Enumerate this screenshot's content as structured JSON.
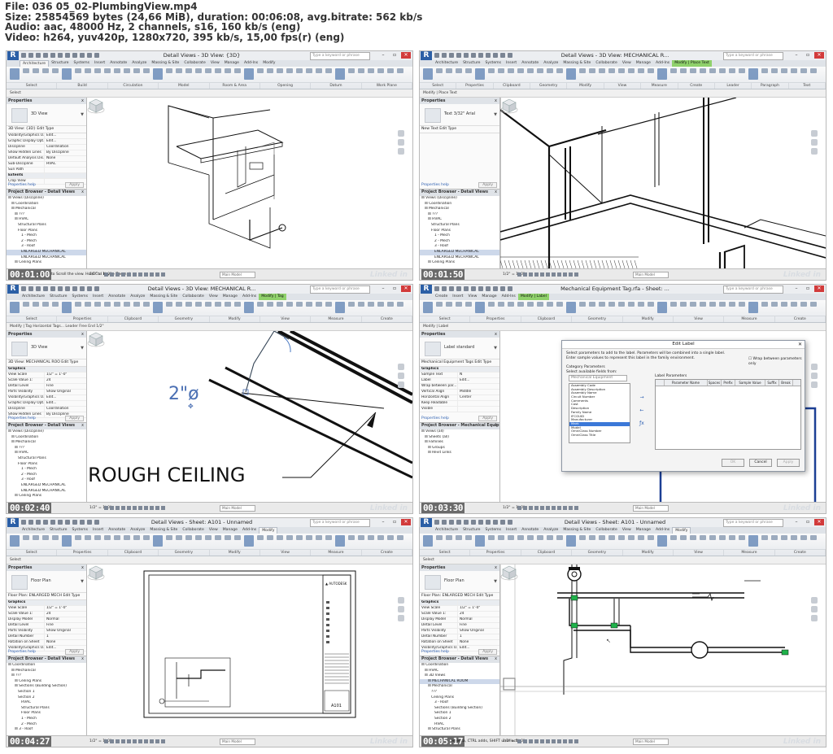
{
  "header": {
    "line1": "File: 036 05_02-PlumbingView.mp4",
    "line2": "Size: 25854569 bytes (24,66 MiB), duration: 00:06:08, avg.bitrate: 562 kb/s",
    "line3": "Audio: aac, 48000 Hz, 2 channels, s16, 160 kb/s (eng)",
    "line4": "Video: h264, yuv420p, 1280x720, 395 kb/s, 15,00 fps(r) (eng)"
  },
  "common": {
    "search_placeholder": "Type a keyword or phrase",
    "scale": "1/2\" = 1'-0\"",
    "model": "Main Model",
    "watermark": "Linked in",
    "apply": "Apply",
    "help": "Properties help",
    "props_title": "Properties",
    "edit_type": "Edit Type"
  },
  "frames": [
    {
      "timestamp": "00:01:00",
      "title": "Detail Views - 3D View: {3D}",
      "tabs": [
        "Architecture",
        "Structure",
        "Systems",
        "Insert",
        "Annotate",
        "Analyze",
        "Massing & Site",
        "Collaborate",
        "View",
        "Manage",
        "Add-Ins",
        "Modify"
      ],
      "active_tab": 0,
      "context_tab": "",
      "panels": [
        "Select",
        "Build",
        "Circulation",
        "Model",
        "Room & Area",
        "Opening",
        "Datum",
        "Work Plane"
      ],
      "ribbon_items": [
        "Roof",
        "Curtain System",
        "Railing",
        "Model Text",
        "Room",
        "Room Separator",
        "Wall",
        "Shaft",
        "Set",
        "Show"
      ],
      "optbar": "Select",
      "type_name": "3D View",
      "selector": "3D View: {3D}",
      "props": [
        [
          "Visibility/Graphics O...",
          "Edit..."
        ],
        [
          "Graphic Display Opt...",
          "Edit..."
        ],
        [
          "Discipline",
          "Coordination"
        ],
        [
          "Show Hidden Lines",
          "By Discipline"
        ],
        [
          "Default Analysis Dis...",
          "None"
        ],
        [
          "Sub-Discipline",
          "HVAC"
        ],
        [
          "Sun Path",
          ""
        ],
        [
          "Extents",
          ""
        ],
        [
          "Crop View",
          ""
        ]
      ],
      "browser_title": "Project Browser - Detail Views",
      "browser": [
        "Views (Discipline)",
        "Coordination",
        "Mechanical",
        "???",
        "HVAC",
        "Structural Plans",
        "Floor Plans",
        "1 - Mech",
        "2 - Mech",
        "3 - Roof",
        "ENLARGED MECHANICAL",
        "ENLARGED MECHANICAL",
        "Ceiling Plans"
      ],
      "browser_sel": 10,
      "status_msg": "mouse to Scroll the view. Hold Ctrl key to Zoom. I",
      "drawing": "iso1"
    },
    {
      "timestamp": "00:01:50",
      "title": "Detail Views - 3D View: MECHANICAL R...",
      "tabs": [
        "Architecture",
        "Structure",
        "Systems",
        "Insert",
        "Annotate",
        "Analyze",
        "Massing & Site",
        "Collaborate",
        "View",
        "Manage",
        "Add-Ins",
        "Modify | Place Text"
      ],
      "active_tab": 11,
      "context_tab": "Modify | Place Text",
      "panels": [
        "Select",
        "Properties",
        "Clipboard",
        "Geometry",
        "Modify",
        "View",
        "Measure",
        "Create",
        "Leader",
        "Paragraph",
        "Text"
      ],
      "ribbon_items": [
        "Cope",
        "Cut",
        "Join",
        "Check Spelling",
        "Find/Replace"
      ],
      "optbar": "Modify | Place Text",
      "type_name": "Text 3/32\" Arial",
      "selector": "New Text",
      "props": [],
      "browser_title": "Project Browser - Detail Views",
      "browser": [
        "Views (Discipline)",
        "Coordination",
        "Mechanical",
        "???",
        "HVAC",
        "Structural Plans",
        "Floor Plans",
        "1 - Mech",
        "2 - Mech",
        "3 - Roof",
        "ENLARGED MECHANICAL",
        "ENLARGED MECHANICAL",
        "Ceiling Plans"
      ],
      "browser_sel": 10,
      "status_msg": "",
      "drawing": "iso2"
    },
    {
      "timestamp": "00:02:40",
      "title": "Detail Views - 3D View: MECHANICAL R...",
      "tabs": [
        "Architecture",
        "Structure",
        "Systems",
        "Insert",
        "Annotate",
        "Analyze",
        "Massing & Site",
        "Collaborate",
        "View",
        "Manage",
        "Add-Ins",
        "Modify | Tag"
      ],
      "active_tab": 11,
      "context_tab": "Modify | Tag",
      "panels": [
        "Select",
        "Properties",
        "Clipboard",
        "Geometry",
        "Modify",
        "View",
        "Measure",
        "Create"
      ],
      "ribbon_items": [
        "Cope",
        "Cut",
        "Join"
      ],
      "optbar": "Modify | Tag   Horizontal   Tags...   Leader   Free End   1/2\"",
      "type_name": "3D View",
      "selector": "3D View: MECHANICAL ROO",
      "props": [
        [
          "Graphics",
          ""
        ],
        [
          "View Scale",
          "1/2\" = 1'-0\""
        ],
        [
          "Scale Value  1:",
          "24"
        ],
        [
          "Detail Level",
          "Fine"
        ],
        [
          "Parts Visibility",
          "Show Original"
        ],
        [
          "Visibility/Graphics O...",
          "Edit..."
        ],
        [
          "Graphic Display Opt...",
          "Edit..."
        ],
        [
          "Discipline",
          "Coordination"
        ],
        [
          "Show Hidden Lines",
          "By Discipline"
        ]
      ],
      "browser_title": "Project Browser - Detail Views",
      "browser": [
        "Views (Discipline)",
        "Coordination",
        "Mechanical",
        "???",
        "HVAC",
        "Structural Plans",
        "Floor Plans",
        "1 - Mech",
        "2 - Mech",
        "3 - Roof",
        "ENLARGED MECHANICAL",
        "ENLARGED MECHANICAL",
        "Ceiling Plans"
      ],
      "browser_sel": -1,
      "status_msg": "",
      "drawing": "closeup",
      "big_label": "2\"ø",
      "big_note": "IROUGH CEILING"
    },
    {
      "timestamp": "00:03:30",
      "title": "Mechanical Equipment Tag.rfa - Sheet: ...",
      "tabs": [
        "Create",
        "Insert",
        "View",
        "Manage",
        "Add-Ins",
        "Modify | Label"
      ],
      "active_tab": 5,
      "context_tab": "Modify | Label",
      "panels": [
        "Select",
        "Properties",
        "Clipboard",
        "Geometry",
        "Modify",
        "View",
        "Measure",
        "Create"
      ],
      "ribbon_items": [
        "Cope",
        "Cut",
        "Join"
      ],
      "optbar": "Modify | Label",
      "type_name": "Label standard",
      "selector": "Mechanical Equipment Tags",
      "props": [
        [
          "Graphics",
          ""
        ],
        [
          "Sample Text",
          "N"
        ],
        [
          "Label",
          "Edit..."
        ],
        [
          "Wrap between par...",
          ""
        ],
        [
          "Vertical Align",
          "Middle"
        ],
        [
          "Horizontal Align",
          "Center"
        ],
        [
          "Keep Readable",
          ""
        ],
        [
          "Visible",
          ""
        ]
      ],
      "browser_title": "Project Browser - Mechanical Equipment Tag...",
      "browser": [
        "Views (all)",
        "Sheets (all)",
        "Families",
        "Groups",
        "Revit Links"
      ],
      "browser_sel": -1,
      "status_msg": "",
      "drawing": "dialog",
      "dialog": {
        "title": "Edit Label",
        "instr1": "Select parameters to add to the label. Parameters will be combined into a single label.",
        "instr2": "Enter sample values to represent this label in the family environment.",
        "wrap": "Wrap between parameters only",
        "cat": "Category Parameters",
        "avail": "Select available fields from:",
        "field_sel": "Mechanical Equipment",
        "fields": [
          "Assembly Code",
          "Assembly Description",
          "Assembly Name",
          "Circuit Number",
          "Comments",
          "Cost",
          "Description",
          "Family Name",
          "IFCGUID",
          "Manufacturer",
          "Mark",
          "Model",
          "OmniClass Number",
          "OmniClass Title"
        ],
        "field_hl": 10,
        "label_params": "Label Parameters",
        "cols": [
          "",
          "Parameter Name",
          "Spaces",
          "Prefix",
          "Sample Value",
          "Suffix",
          "Break"
        ],
        "ok": "OK",
        "cancel": "Cancel",
        "apply": "Apply"
      }
    },
    {
      "timestamp": "00:04:27",
      "title": "Detail Views - Sheet: A101 - Unnamed",
      "tabs": [
        "Architecture",
        "Structure",
        "Systems",
        "Insert",
        "Annotate",
        "Analyze",
        "Massing & Site",
        "Collaborate",
        "View",
        "Manage",
        "Add-Ins",
        "Modify"
      ],
      "active_tab": 11,
      "context_tab": "",
      "panels": [
        "Select",
        "Properties",
        "Clipboard",
        "Geometry",
        "Modify",
        "View",
        "Measure",
        "Create"
      ],
      "ribbon_items": [
        "Cope",
        "Cut",
        "Join"
      ],
      "optbar": "Select",
      "type_name": "Floor Plan",
      "selector": "Floor Plan: ENLARGED MECH",
      "props": [
        [
          "Graphics",
          ""
        ],
        [
          "View Scale",
          "1/2\" = 1'-0\""
        ],
        [
          "Scale Value  1:",
          "24"
        ],
        [
          "Display Model",
          "Normal"
        ],
        [
          "Detail Level",
          "Fine"
        ],
        [
          "Parts Visibility",
          "Show Original"
        ],
        [
          "Detail Number",
          "1"
        ],
        [
          "Rotation on Sheet",
          "None"
        ],
        [
          "Visibility/Graphics O...",
          "Edit..."
        ]
      ],
      "browser_title": "Project Browser - Detail Views",
      "browser": [
        "Coordination",
        "Mechanical",
        "???",
        "Ceiling Plans",
        "Sections (Building Section)",
        "Section 1",
        "Section 2",
        "HVAC",
        "Structural Plans",
        "Floor Plans",
        "1 - Mech",
        "2 - Mech",
        "3 - Roof"
      ],
      "browser_sel": -1,
      "status_msg": "",
      "drawing": "sheet",
      "sheet_logo": "AUTODESK",
      "sheet_no": "A101"
    },
    {
      "timestamp": "00:05:17",
      "title": "Detail Views - Sheet: A101 - Unnamed",
      "tabs": [
        "Architecture",
        "Structure",
        "Systems",
        "Insert",
        "Annotate",
        "Analyze",
        "Massing & Site",
        "Collaborate",
        "View",
        "Manage",
        "Add-Ins",
        "Modify"
      ],
      "active_tab": 11,
      "context_tab": "",
      "panels": [
        "Select",
        "Properties",
        "Clipboard",
        "Geometry",
        "Modify",
        "View",
        "Measure",
        "Create"
      ],
      "ribbon_items": [
        "Cope",
        "Cut",
        "Join"
      ],
      "optbar": "Select",
      "type_name": "Floor Plan",
      "selector": "Floor Plan: ENLARGED MECH",
      "props": [
        [
          "Graphics",
          ""
        ],
        [
          "View Scale",
          "1/2\" = 1'-0\""
        ],
        [
          "Scale Value  1:",
          "24"
        ],
        [
          "Display Model",
          "Normal"
        ],
        [
          "Detail Level",
          "Fine"
        ],
        [
          "Parts Visibility",
          "Show Original"
        ],
        [
          "Detail Number",
          "1"
        ],
        [
          "Rotation on Sheet",
          "None"
        ],
        [
          "Visibility/Graphics O...",
          "Edit..."
        ]
      ],
      "browser_title": "Project Browser - Detail Views",
      "browser": [
        "Coordination",
        "HVAC",
        "3D Views",
        "MECHANICAL ROOM",
        "Mechanical",
        "???",
        "Ceiling Plans",
        "3 - Roof",
        "Sections (Building Section)",
        "Section 1",
        "Section 2",
        "HVAC",
        "Structural Plans"
      ],
      "browser_sel": 3,
      "status_msg": "ementa, CTRL adds, SHIFT unselects.",
      "drawing": "plan"
    }
  ]
}
